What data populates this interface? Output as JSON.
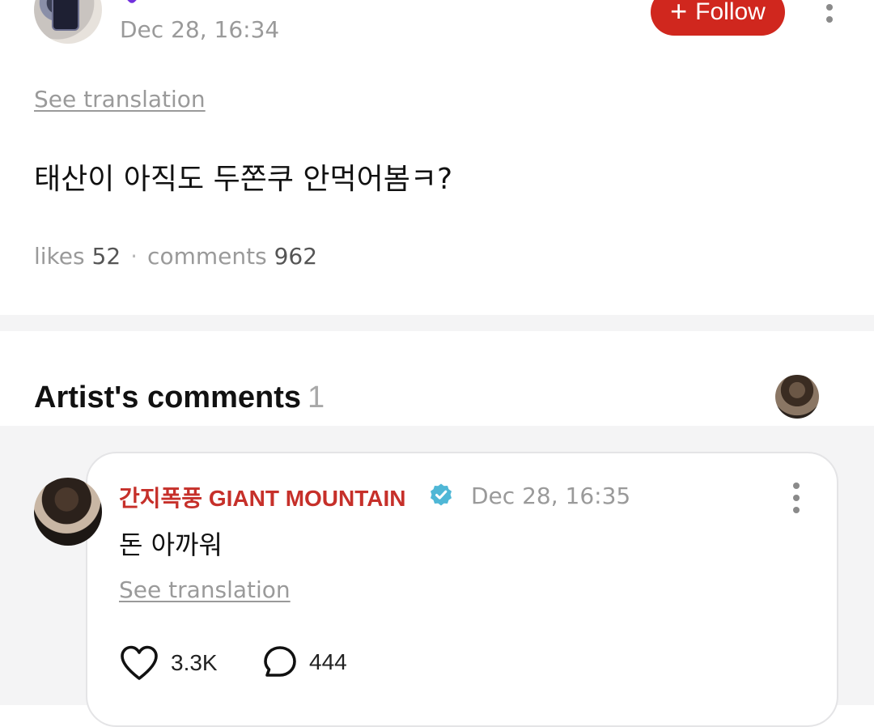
{
  "post": {
    "author_name": "",
    "time": "Dec 28, 16:34",
    "follow_label": "Follow",
    "follow_icon": "+",
    "see_translation": "See translation",
    "text": "태산이 아직도 두쫀쿠 안먹어봄ㅋ?",
    "stats": {
      "likes_label": "likes",
      "likes": "52",
      "separator": "·",
      "comments_label": "comments",
      "comments": "962"
    }
  },
  "artist_comments": {
    "title": "Artist's comments",
    "count": "1",
    "comment": {
      "author": "간지폭풍 GIANT MOUNTAIN",
      "time": "Dec 28, 16:35",
      "text": "돈 아까워",
      "see_translation": "See translation",
      "likes": "3.3K",
      "replies": "444"
    }
  },
  "colors": {
    "accent_red": "#d0271e",
    "artist_name": "#c6302a",
    "verified": "#4fb7d6",
    "muted_text": "#9a9a9a",
    "band_bg": "#f4f4f5"
  },
  "icons": {
    "follow": "plus-icon",
    "menu": "more-vertical-icon",
    "verified": "verified-badge-icon",
    "like": "heart-icon",
    "reply": "comment-bubble-icon"
  }
}
